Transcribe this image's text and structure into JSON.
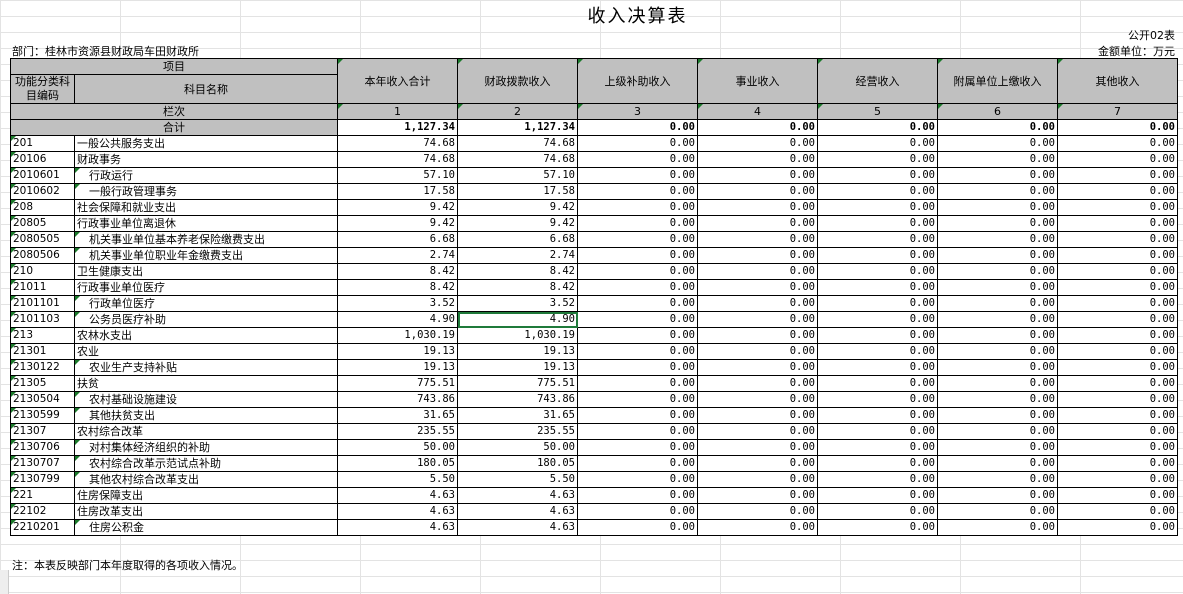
{
  "title": "收入决算表",
  "table_no": "公开02表",
  "department": "部门：桂林市资源县财政局车田财政所",
  "unit": "金额单位：万元",
  "headers": {
    "item": "项目",
    "code": "功能分类科目编码",
    "name": "科目名称",
    "column_no": "栏次",
    "total_label": "合计",
    "cols": [
      "本年收入合计",
      "财政拨款收入",
      "上级补助收入",
      "事业收入",
      "经营收入",
      "附属单位上缴收入",
      "其他收入"
    ],
    "col_nums": [
      "1",
      "2",
      "3",
      "4",
      "5",
      "6",
      "7"
    ]
  },
  "totals": [
    "1,127.34",
    "1,127.34",
    "0.00",
    "0.00",
    "0.00",
    "0.00",
    "0.00"
  ],
  "rows": [
    {
      "code": "201",
      "name": "一般公共服务支出",
      "v1": "74.68",
      "v2": "74.68"
    },
    {
      "code": "20106",
      "name": "财政事务",
      "v1": "74.68",
      "v2": "74.68"
    },
    {
      "code": "2010601",
      "name": "行政运行",
      "v1": "57.10",
      "v2": "57.10"
    },
    {
      "code": "2010602",
      "name": "一般行政管理事务",
      "v1": "17.58",
      "v2": "17.58"
    },
    {
      "code": "208",
      "name": "社会保障和就业支出",
      "v1": "9.42",
      "v2": "9.42"
    },
    {
      "code": "20805",
      "name": "行政事业单位离退休",
      "v1": "9.42",
      "v2": "9.42"
    },
    {
      "code": "2080505",
      "name": "机关事业单位基本养老保险缴费支出",
      "v1": "6.68",
      "v2": "6.68"
    },
    {
      "code": "2080506",
      "name": "机关事业单位职业年金缴费支出",
      "v1": "2.74",
      "v2": "2.74"
    },
    {
      "code": "210",
      "name": "卫生健康支出",
      "v1": "8.42",
      "v2": "8.42"
    },
    {
      "code": "21011",
      "name": "行政事业单位医疗",
      "v1": "8.42",
      "v2": "8.42"
    },
    {
      "code": "2101101",
      "name": "行政单位医疗",
      "v1": "3.52",
      "v2": "3.52"
    },
    {
      "code": "2101103",
      "name": "公务员医疗补助",
      "v1": "4.90",
      "v2": "4.90"
    },
    {
      "code": "213",
      "name": "农林水支出",
      "v1": "1,030.19",
      "v2": "1,030.19"
    },
    {
      "code": "21301",
      "name": "农业",
      "v1": "19.13",
      "v2": "19.13"
    },
    {
      "code": "2130122",
      "name": "农业生产支持补贴",
      "v1": "19.13",
      "v2": "19.13"
    },
    {
      "code": "21305",
      "name": "扶贫",
      "v1": "775.51",
      "v2": "775.51"
    },
    {
      "code": "2130504",
      "name": "农村基础设施建设",
      "v1": "743.86",
      "v2": "743.86"
    },
    {
      "code": "2130599",
      "name": "其他扶贫支出",
      "v1": "31.65",
      "v2": "31.65"
    },
    {
      "code": "21307",
      "name": "农村综合改革",
      "v1": "235.55",
      "v2": "235.55"
    },
    {
      "code": "2130706",
      "name": "对村集体经济组织的补助",
      "v1": "50.00",
      "v2": "50.00"
    },
    {
      "code": "2130707",
      "name": "农村综合改革示范试点补助",
      "v1": "180.05",
      "v2": "180.05"
    },
    {
      "code": "2130799",
      "name": "其他农村综合改革支出",
      "v1": "5.50",
      "v2": "5.50"
    },
    {
      "code": "221",
      "name": "住房保障支出",
      "v1": "4.63",
      "v2": "4.63"
    },
    {
      "code": "22102",
      "name": "住房改革支出",
      "v1": "4.63",
      "v2": "4.63"
    },
    {
      "code": "2210201",
      "name": "住房公积金",
      "v1": "4.63",
      "v2": "4.63"
    }
  ],
  "zero": "0.00",
  "note": "注：本表反映部门本年度取得的各项收入情况。"
}
